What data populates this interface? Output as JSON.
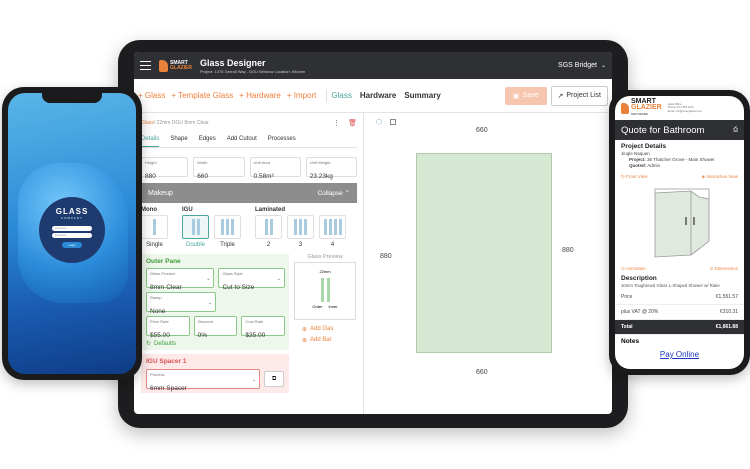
{
  "tablet": {
    "user": "SGS Bridget",
    "app": {
      "logo_line1": "SMART",
      "logo_line2": "GLAZIER",
      "title": "Glass Designer",
      "subtitle": "Project: 1275 Gerrall Way - DGU Window   Location: Kitchen"
    },
    "nav": {
      "add_glass": "+ Glass",
      "add_template": "+ Template Glass",
      "add_hardware": "+ Hardware",
      "import": "+ Import",
      "tabs": [
        "Glass",
        "Hardware",
        "Summary"
      ],
      "save": "Save",
      "project_list": "Project List"
    },
    "panel": {
      "crumb_root": "Glass",
      "crumb_item": "/ 22mm DGU 8mm Clear",
      "subtabs": [
        "Details",
        "Shape",
        "Edges",
        "Add Cutout",
        "Processes"
      ],
      "dims": [
        {
          "label": "Height",
          "value": "880"
        },
        {
          "label": "Width",
          "value": "660"
        },
        {
          "label": "Unit Area",
          "value": "0.58m²"
        },
        {
          "label": "Unit Weight",
          "value": "23.23kg"
        }
      ],
      "makeup_title": "Makeup",
      "collapse": "Collapse",
      "groups": {
        "mono": "Mono",
        "igu": "IGU",
        "laminated": "Laminated"
      },
      "types": [
        "Single",
        "Double",
        "Triple",
        "2",
        "3",
        "4"
      ],
      "outer_pane": {
        "title": "Outer Pane",
        "glass_product_label": "Glass Product",
        "glass_product": "8mm Clear",
        "glass_style_label": "Glass Style",
        "glass_style": "Cut to Size",
        "stamp_label": "Stamp",
        "stamp": "None",
        "price_rate_label": "Price Rate",
        "price_rate": "$55.00",
        "discount_label": "Discount",
        "discount": "0%",
        "cost_rate_label": "Cost Rate",
        "cost_rate": "$35.00",
        "defaults": "Defaults"
      },
      "preview": {
        "title": "Glass Preview",
        "mm": "22mm",
        "outer": "Outer",
        "inner": "Inner"
      },
      "add_gas": "Add Gas",
      "add_bar": "Add Bar",
      "spacer": {
        "title": "IGU Spacer 1",
        "process_label": "Process",
        "process": "6mm Spacer"
      }
    },
    "canvas": {
      "top": "660",
      "bottom": "660",
      "left": "880",
      "right": "880"
    }
  },
  "login_phone": {
    "brand": "GLASS",
    "brand_sub": "COMPANY",
    "username_placeholder": "Username",
    "password_placeholder": "Password",
    "login": "Login"
  },
  "quote_phone": {
    "logo_line1": "SMART",
    "logo_line2": "GLAZIER",
    "logo_line3": "SOFTWARE",
    "contact": [
      "Head Office",
      "Phone: 09 X 556 6222",
      "Email: info@smartglazier.com"
    ],
    "title": "Quote for Bathroom",
    "project_details": "Project Details",
    "client": "Jingle Naquen",
    "project_label": "Project:",
    "project": "36 Thatcher Grove - Main Shower",
    "quoted_label": "Quoted:",
    "quoted": "Admin",
    "front_view": "Front View",
    "interactive_view": "Interactive View",
    "animation": "Animation",
    "dimensions": "Dimensions",
    "description_h": "Description",
    "description": "10mm Toughened Glass L-Shaped Shower w/ Rake",
    "rows": [
      {
        "label": "Price",
        "value": "€1,551.57"
      },
      {
        "label": "plus VAT @ 20%",
        "value": "€310.31"
      },
      {
        "label": "Total",
        "value": "€1,861.88"
      }
    ],
    "notes": "Notes",
    "pay": "Pay Online"
  }
}
